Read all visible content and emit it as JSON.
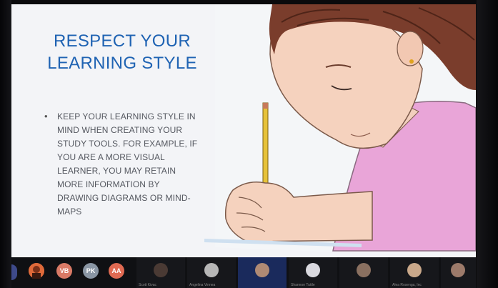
{
  "slide": {
    "title_line1": "RESPECT YOUR",
    "title_line2": "LEARNING STYLE",
    "bullet": "KEEP YOUR LEARNING STYLE IN MIND WHEN CREATING YOUR STUDY TOOLS. FOR EXAMPLE, IF YOU ARE A MORE VISUAL LEARNER, YOU MAY RETAIN MORE INFORMATION BY DRAWING DIAGRAMS OR MIND-MAPS",
    "title_color": "#1f63b3",
    "text_color": "#555860"
  },
  "participants": {
    "initial_avatars": [
      {
        "initials": "VB",
        "color": "#d97a66"
      },
      {
        "initials": "PK",
        "color": "#8a96a4"
      },
      {
        "initials": "AA",
        "color": "#e06a52"
      }
    ],
    "tiles": [
      {
        "label": "Scott Kivac"
      },
      {
        "label": "Angelina Vinnea"
      },
      {
        "label": ""
      },
      {
        "label": "Shannon Tuttle"
      },
      {
        "label": ""
      },
      {
        "label": "Alea Rosenga, Inc"
      },
      {
        "label": ""
      },
      {
        "label": ""
      }
    ]
  }
}
